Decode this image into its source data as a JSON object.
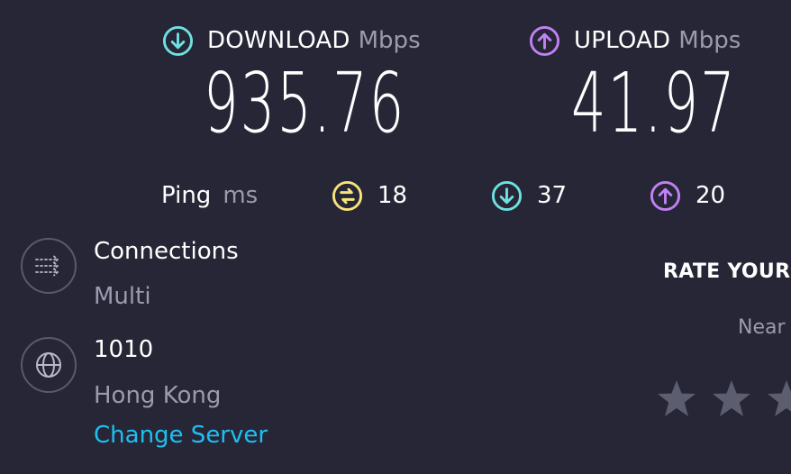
{
  "download": {
    "label": "DOWNLOAD",
    "unit": "Mbps",
    "value": "935.76",
    "icon": "arrow-down-circle-icon",
    "color": "#6fe0e0"
  },
  "upload": {
    "label": "UPLOAD",
    "unit": "Mbps",
    "value": "41.97",
    "icon": "arrow-up-circle-icon",
    "color": "#c181f2"
  },
  "ping": {
    "label": "Ping",
    "unit": "ms",
    "idle": {
      "value": "18",
      "icon": "idle-latency-icon",
      "color": "#f6e37a"
    },
    "download": {
      "value": "37",
      "icon": "arrow-down-circle-icon",
      "color": "#6fe0e0"
    },
    "upload": {
      "value": "20",
      "icon": "arrow-up-circle-icon",
      "color": "#c181f2"
    }
  },
  "connections": {
    "title": "Connections",
    "value": "Multi",
    "icon": "connections-icon"
  },
  "server": {
    "name": "1010",
    "location": "Hong Kong",
    "change_label": "Change Server",
    "icon": "globe-icon"
  },
  "rating": {
    "title": "RATE YOUR",
    "hint": "Near",
    "stars": 3,
    "star_color": "#5d5d70"
  },
  "colors": {
    "background": "#262637",
    "muted": "#9b9bad",
    "link": "#1ec0f0"
  }
}
